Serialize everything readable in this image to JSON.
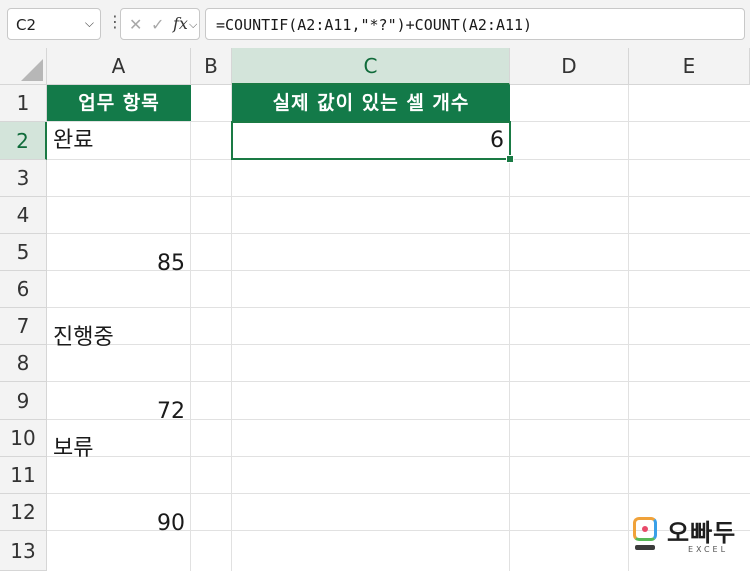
{
  "formula_bar": {
    "name_box": "C2",
    "formula": "=COUNTIF(A2:A11,\"*?\")+COUNT(A2:A11)"
  },
  "columns": [
    "A",
    "B",
    "C",
    "D",
    "E"
  ],
  "rows": [
    "1",
    "2",
    "3",
    "4",
    "5",
    "6",
    "7",
    "8",
    "9",
    "10",
    "11",
    "12",
    "13"
  ],
  "selected": {
    "column": "C",
    "row": "2"
  },
  "cells": {
    "A1": "업무 항목",
    "C1": "실제 값이 있는 셀 개수",
    "A2": "완료",
    "C2": "6",
    "A4": "85",
    "A6": "진행중",
    "A8": "72",
    "A9": "보류",
    "A11": "90"
  },
  "logo": {
    "word": "오빠두",
    "sub": "EXCEL"
  },
  "colors": {
    "header_fill": "#137a49",
    "selection": "#1a7a44"
  }
}
